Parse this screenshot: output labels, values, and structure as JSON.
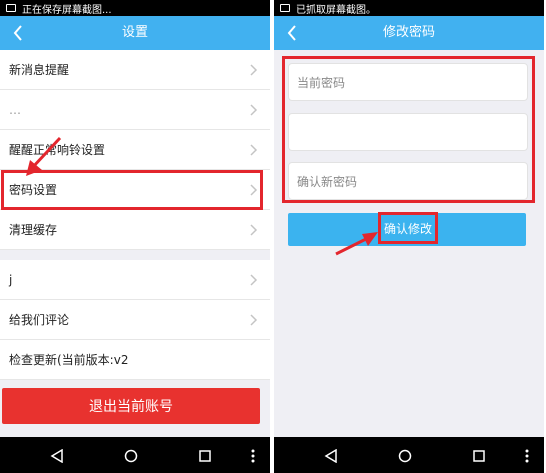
{
  "left": {
    "status_text": "正在保存屏幕截图...",
    "title": "设置",
    "menu": [
      {
        "label": "新消息提醒"
      },
      {
        "label": "…"
      },
      {
        "label": "醒醒正常响铃设置"
      },
      {
        "label": "密码设置"
      },
      {
        "label": "清理缓存"
      },
      {
        "label": "j"
      },
      {
        "label": "给我们评论"
      },
      {
        "label": "检查更新(当前版本:v2"
      }
    ],
    "logout_label": "退出当前账号"
  },
  "right": {
    "status_text": "已抓取屏幕截图。",
    "title": "修改密码",
    "fields": [
      {
        "placeholder": "当前密码"
      },
      {
        "placeholder": ""
      },
      {
        "placeholder": "确认新密码"
      }
    ],
    "confirm_label": "确认修改"
  },
  "colors": {
    "accent": "#41b1f0",
    "danger": "#e8322f",
    "highlight": "#e3262d"
  },
  "icons": [
    "back-arrow-icon",
    "chevron-right-icon",
    "nav-back-icon",
    "nav-home-icon",
    "nav-recents-icon",
    "nav-menu-icon",
    "screenshot-icon"
  ]
}
